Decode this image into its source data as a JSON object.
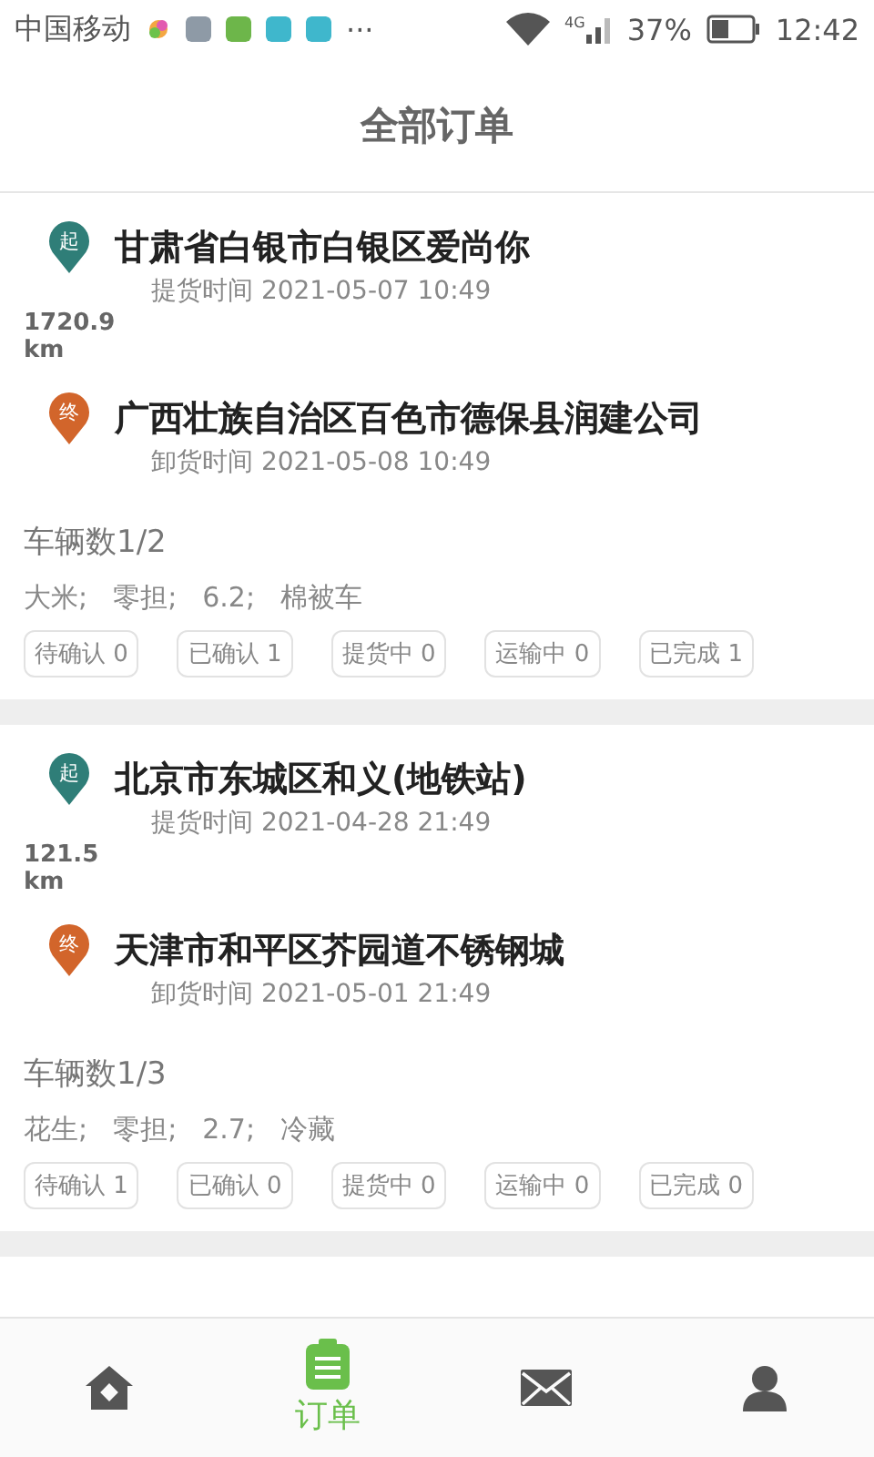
{
  "status_bar": {
    "carrier": "中国移动",
    "more": "···",
    "network": "4G",
    "battery": "37%",
    "time": "12:42"
  },
  "header": {
    "title": "全部订单"
  },
  "orders": [
    {
      "stops": [
        {
          "kind": "start",
          "badge": "起",
          "address": "甘肃省白银市白银区爱尚你",
          "time": "提货时间 2021-05-07 10:49"
        },
        {
          "kind": "end",
          "badge": "终",
          "address": "广西壮族自治区百色市德保县润建公司",
          "time": "卸货时间 2021-05-08 10:49"
        }
      ],
      "distance": "1720.9 km",
      "vehicles": "车辆数1/2",
      "cargo": [
        "大米;",
        "零担;",
        "6.2;",
        "棉被车"
      ],
      "counts": [
        "待确认 0",
        "已确认 1",
        "提货中 0",
        "运输中 0",
        "已完成 1"
      ]
    },
    {
      "stops": [
        {
          "kind": "start",
          "badge": "起",
          "address": "北京市东城区和义(地铁站)",
          "time": "提货时间 2021-04-28 21:49"
        },
        {
          "kind": "end",
          "badge": "终",
          "address": "天津市和平区芥园道不锈钢城",
          "time": "卸货时间 2021-05-01 21:49"
        }
      ],
      "distance": "121.5 km",
      "vehicles": "车辆数1/3",
      "cargo": [
        "花生;",
        "零担;",
        "2.7;",
        "冷藏"
      ],
      "counts": [
        "待确认 1",
        "已确认 0",
        "提货中 0",
        "运输中 0",
        "已完成 0"
      ]
    }
  ],
  "tabs": [
    {
      "kind": "home",
      "selected": false
    },
    {
      "kind": "orders",
      "label": "订单",
      "selected": true
    },
    {
      "kind": "mail",
      "selected": false
    },
    {
      "kind": "profile",
      "selected": false
    }
  ]
}
